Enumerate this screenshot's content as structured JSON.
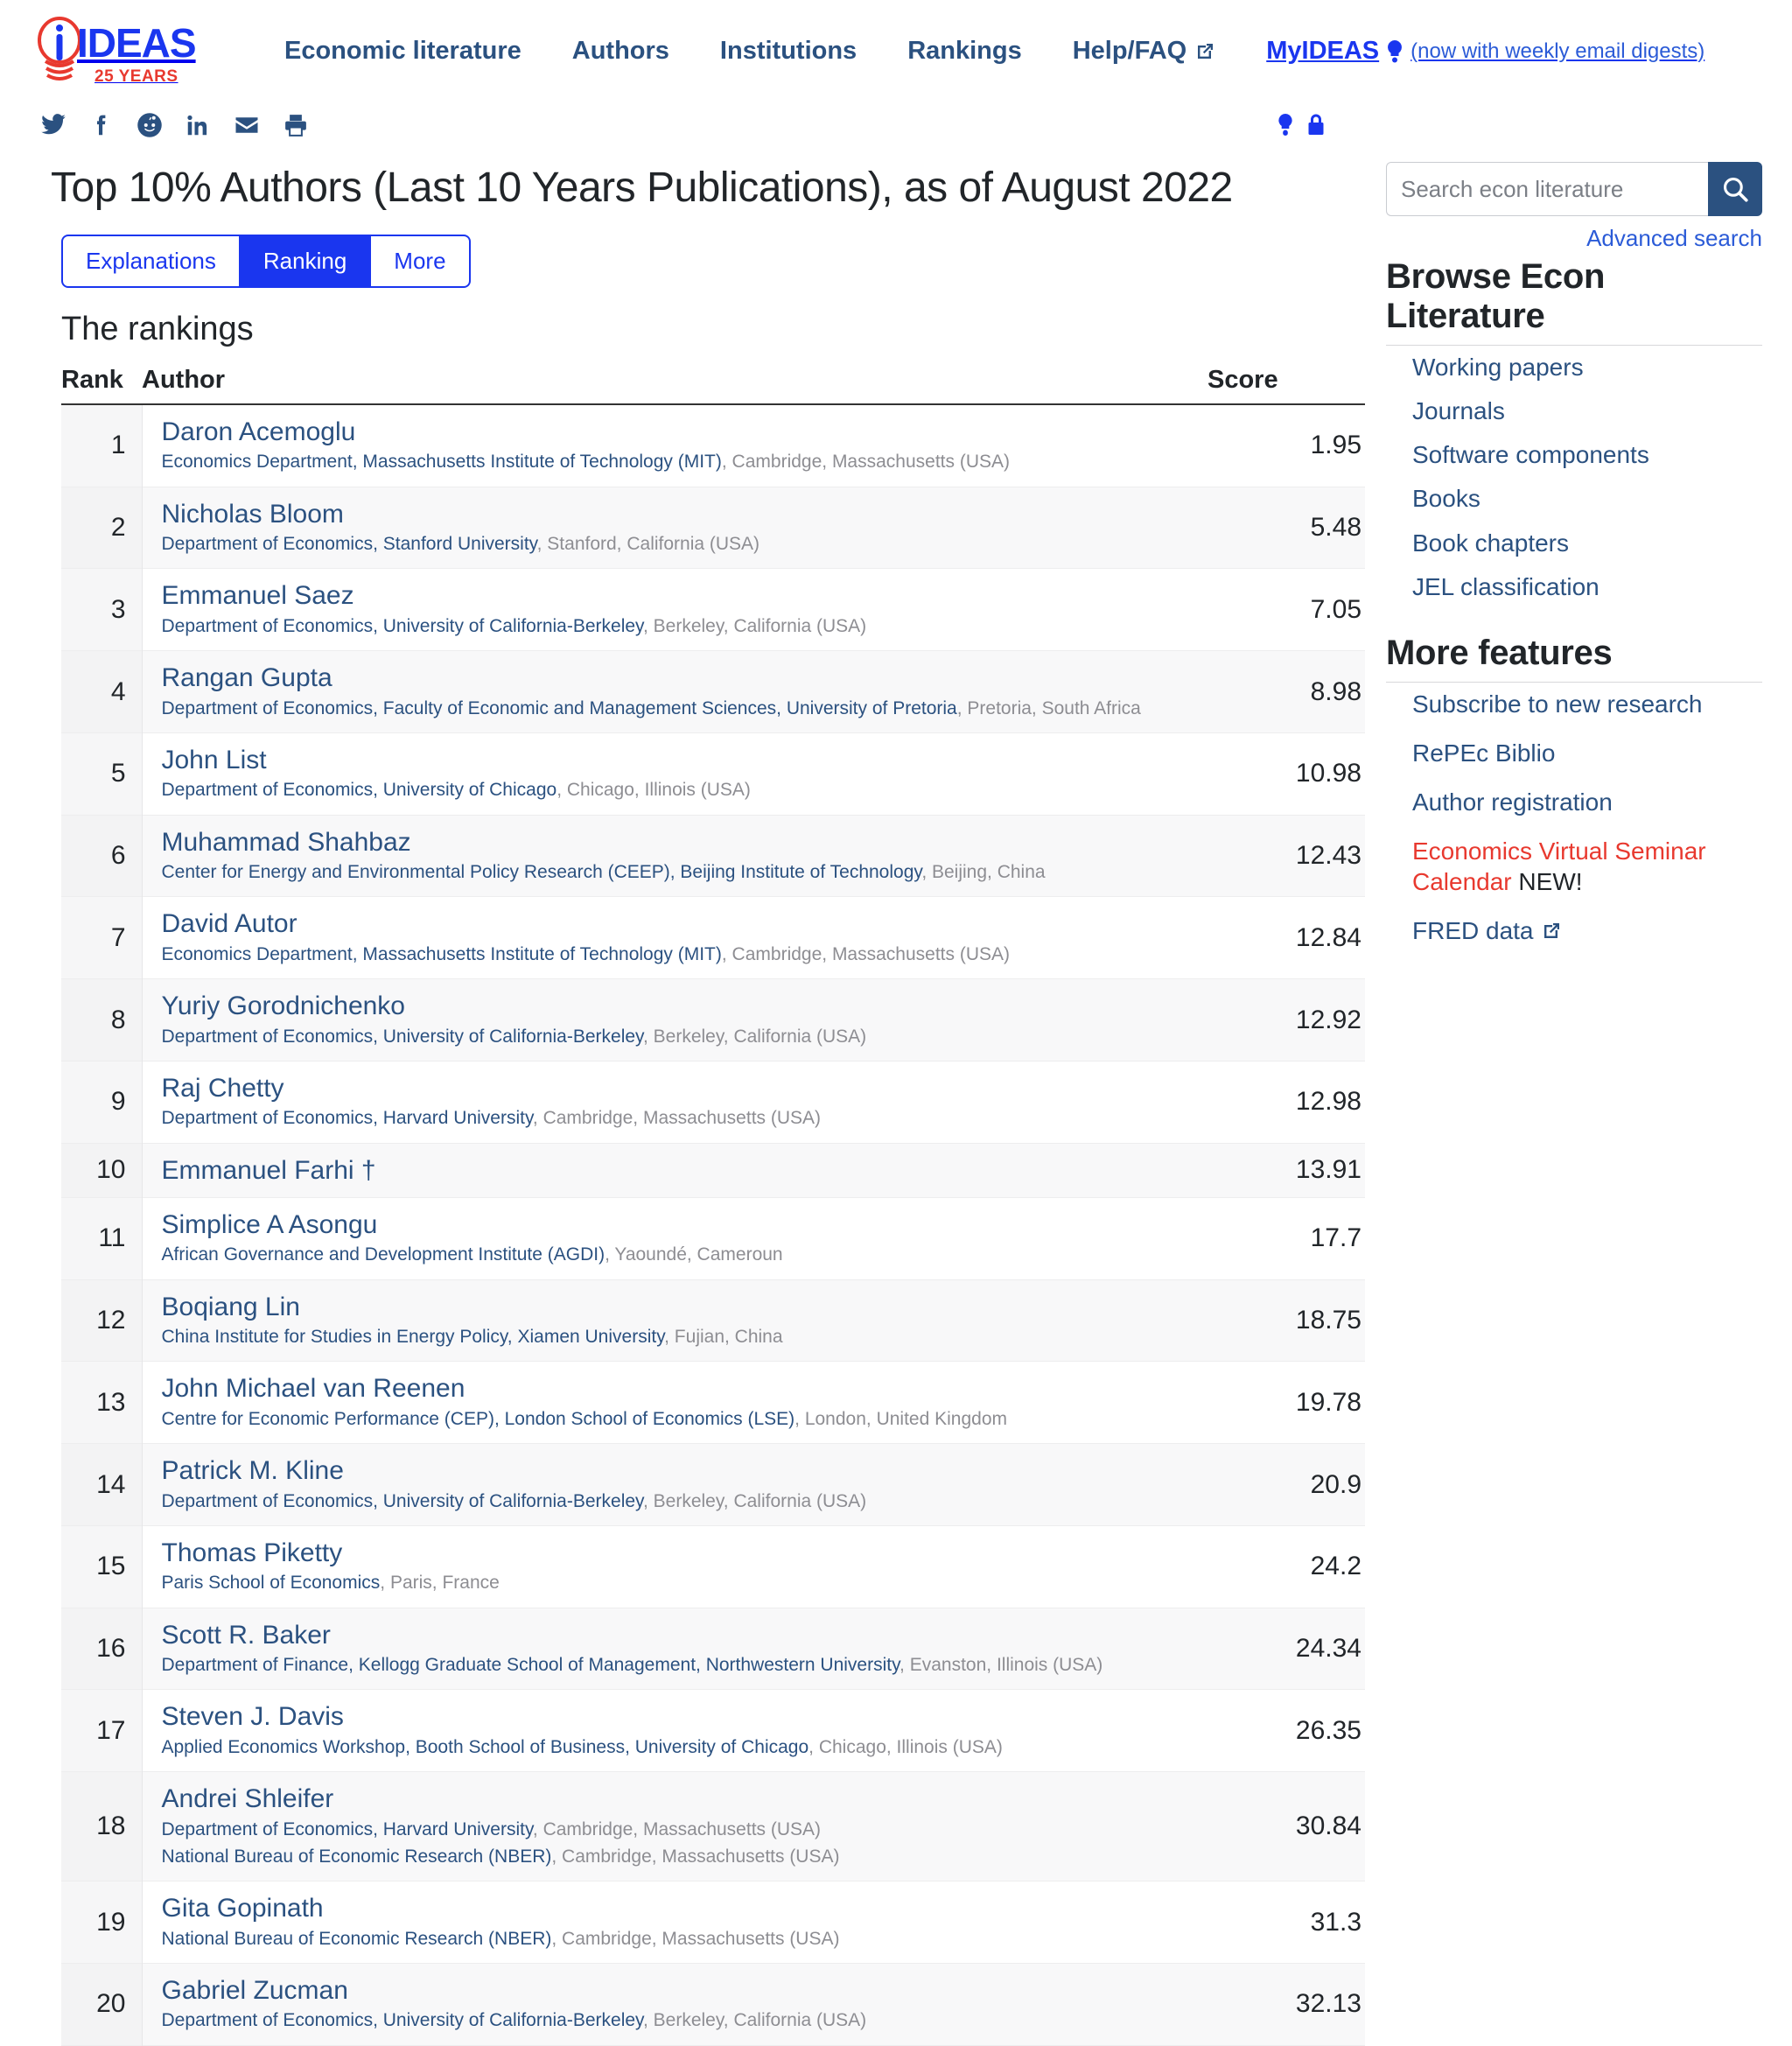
{
  "brand": {
    "name": "IDEAS",
    "tagline": "25 YEARS",
    "logo_icon": "lightbulb-icon"
  },
  "nav": {
    "items": [
      {
        "label": "Economic literature",
        "external": false
      },
      {
        "label": "Authors",
        "external": false
      },
      {
        "label": "Institutions",
        "external": false
      },
      {
        "label": "Rankings",
        "external": false
      },
      {
        "label": "Help/FAQ",
        "external": true
      }
    ],
    "myideas": {
      "label": "MyIDEAS",
      "icon": "lightbulb-icon",
      "note": "(now with weekly email digests)"
    }
  },
  "share": {
    "icons": [
      "twitter-icon",
      "facebook-icon",
      "reddit-icon",
      "linkedin-icon",
      "email-icon",
      "print-icon"
    ],
    "corner_icons": [
      "lightbulb-icon",
      "lock-icon"
    ]
  },
  "header": {
    "title": "Top 10% Authors (Last 10 Years Publications), as of August 2022"
  },
  "tabs": [
    {
      "label": "Explanations",
      "active": false
    },
    {
      "label": "Ranking",
      "active": true
    },
    {
      "label": "More",
      "active": false
    }
  ],
  "section": {
    "title": "The rankings"
  },
  "table": {
    "columns": {
      "rank": "Rank",
      "author": "Author",
      "score": "Score"
    },
    "rows": [
      {
        "rank": "1",
        "author": "Daron Acemoglu",
        "score": "1.95",
        "affiliations": [
          {
            "link": "Economics Department, Massachusetts Institute of Technology (MIT)",
            "plain": ", Cambridge, Massachusetts (USA)"
          }
        ]
      },
      {
        "rank": "2",
        "author": "Nicholas Bloom",
        "score": "5.48",
        "affiliations": [
          {
            "link": "Department of Economics, Stanford University",
            "plain": ", Stanford, California (USA)"
          }
        ]
      },
      {
        "rank": "3",
        "author": "Emmanuel Saez",
        "score": "7.05",
        "affiliations": [
          {
            "link": "Department of Economics, University of California-Berkeley",
            "plain": ", Berkeley, California (USA)"
          }
        ]
      },
      {
        "rank": "4",
        "author": "Rangan Gupta",
        "score": "8.98",
        "affiliations": [
          {
            "link": "Department of Economics, Faculty of Economic and Management Sciences, University of Pretoria",
            "plain": ", Pretoria, South Africa"
          }
        ]
      },
      {
        "rank": "5",
        "author": "John List",
        "score": "10.98",
        "affiliations": [
          {
            "link": "Department of Economics, University of Chicago",
            "plain": ", Chicago, Illinois (USA)"
          }
        ]
      },
      {
        "rank": "6",
        "author": "Muhammad Shahbaz",
        "score": "12.43",
        "affiliations": [
          {
            "link": "Center for Energy and Environmental Policy Research (CEEP), Beijing Institute of Technology",
            "plain": ", Beijing, China"
          }
        ]
      },
      {
        "rank": "7",
        "author": "David Autor",
        "score": "12.84",
        "affiliations": [
          {
            "link": "Economics Department, Massachusetts Institute of Technology (MIT)",
            "plain": ", Cambridge, Massachusetts (USA)"
          }
        ]
      },
      {
        "rank": "8",
        "author": "Yuriy Gorodnichenko",
        "score": "12.92",
        "affiliations": [
          {
            "link": "Department of Economics, University of California-Berkeley",
            "plain": ", Berkeley, California (USA)"
          }
        ]
      },
      {
        "rank": "9",
        "author": "Raj Chetty",
        "score": "12.98",
        "affiliations": [
          {
            "link": "Department of Economics, Harvard University",
            "plain": ", Cambridge, Massachusetts (USA)"
          }
        ]
      },
      {
        "rank": "10",
        "author": "Emmanuel Farhi †",
        "score": "13.91",
        "affiliations": []
      },
      {
        "rank": "11",
        "author": "Simplice A Asongu",
        "score": "17.7",
        "affiliations": [
          {
            "link": "African Governance and Development Institute (AGDI)",
            "plain": ", Yaoundé, Cameroun"
          }
        ]
      },
      {
        "rank": "12",
        "author": "Boqiang Lin",
        "score": "18.75",
        "affiliations": [
          {
            "link": "China Institute for Studies in Energy Policy, Xiamen University",
            "plain": ", Fujian, China"
          }
        ]
      },
      {
        "rank": "13",
        "author": "John Michael van Reenen",
        "score": "19.78",
        "affiliations": [
          {
            "link": "Centre for Economic Performance (CEP), London School of Economics (LSE)",
            "plain": ", London, United Kingdom"
          }
        ]
      },
      {
        "rank": "14",
        "author": "Patrick M. Kline",
        "score": "20.9",
        "affiliations": [
          {
            "link": "Department of Economics, University of California-Berkeley",
            "plain": ", Berkeley, California (USA)"
          }
        ]
      },
      {
        "rank": "15",
        "author": "Thomas Piketty",
        "score": "24.2",
        "affiliations": [
          {
            "link": "Paris School of Economics",
            "plain": ", Paris, France"
          }
        ]
      },
      {
        "rank": "16",
        "author": "Scott R. Baker",
        "score": "24.34",
        "affiliations": [
          {
            "link": "Department of Finance, Kellogg Graduate School of Management, Northwestern University",
            "plain": ", Evanston, Illinois (USA)"
          }
        ]
      },
      {
        "rank": "17",
        "author": "Steven J. Davis",
        "score": "26.35",
        "affiliations": [
          {
            "link": "Applied Economics Workshop, Booth School of Business, University of Chicago",
            "plain": ", Chicago, Illinois (USA)"
          }
        ]
      },
      {
        "rank": "18",
        "author": "Andrei Shleifer",
        "score": "30.84",
        "affiliations": [
          {
            "link": "Department of Economics, Harvard University",
            "plain": ", Cambridge, Massachusetts (USA)"
          },
          {
            "link": "National Bureau of Economic Research (NBER)",
            "plain": ", Cambridge, Massachusetts (USA)"
          }
        ]
      },
      {
        "rank": "19",
        "author": "Gita Gopinath",
        "score": "31.3",
        "affiliations": [
          {
            "link": "National Bureau of Economic Research (NBER)",
            "plain": ", Cambridge, Massachusetts (USA)"
          }
        ]
      },
      {
        "rank": "20",
        "author": "Gabriel Zucman",
        "score": "32.13",
        "affiliations": [
          {
            "link": "Department of Economics, University of California-Berkeley",
            "plain": ", Berkeley, California (USA)"
          }
        ]
      }
    ]
  },
  "sidebar": {
    "search": {
      "placeholder": "Search econ literature",
      "value": "",
      "button_icon": "search-icon"
    },
    "advanced_search": "Advanced search",
    "browse": {
      "title": "Browse Econ Literature",
      "items": [
        {
          "label": "Working papers"
        },
        {
          "label": "Journals"
        },
        {
          "label": "Software components"
        },
        {
          "label": "Books"
        },
        {
          "label": "Book chapters"
        },
        {
          "label": "JEL classification"
        }
      ]
    },
    "features": {
      "title": "More features",
      "items": [
        {
          "label": "Subscribe to new research",
          "red": false,
          "external": false,
          "tag": ""
        },
        {
          "label": "RePEc Biblio",
          "red": false,
          "external": false,
          "tag": ""
        },
        {
          "label": "Author registration",
          "red": false,
          "external": false,
          "tag": ""
        },
        {
          "label": "Economics Virtual Seminar Calendar",
          "red": true,
          "external": false,
          "tag": " NEW!"
        },
        {
          "label": "FRED data",
          "red": false,
          "external": true,
          "tag": ""
        }
      ]
    }
  },
  "colors": {
    "brand_blue": "#1a36ef",
    "brand_red": "#e8392f",
    "link_blue": "#2b5180",
    "accent_blue": "#2b5bd7"
  }
}
